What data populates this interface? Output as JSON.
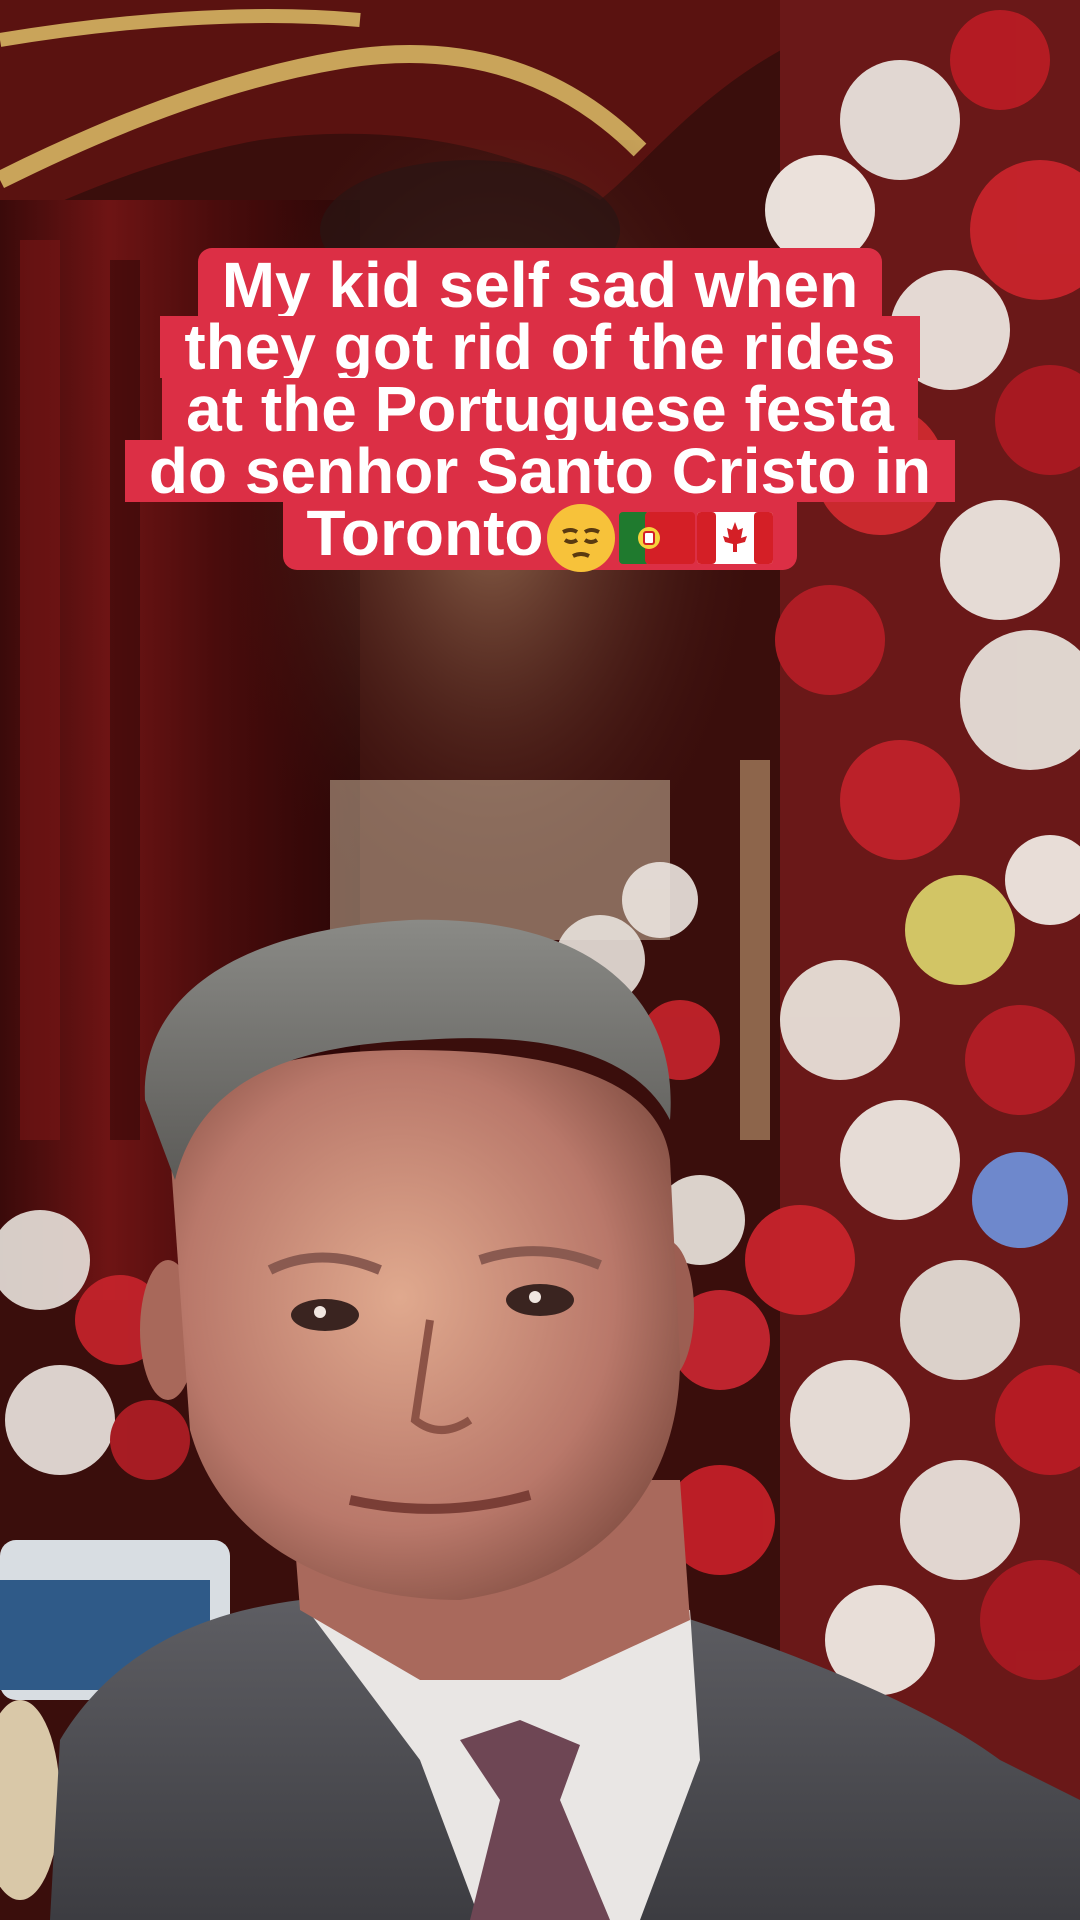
{
  "caption": {
    "lines": [
      "My kid self sad when",
      "they got rid of the rides",
      "at the Portuguese festa",
      "do senhor Santo Cristo in",
      "Toronto"
    ],
    "trailing_emojis": [
      "pensive-face",
      "portugal-flag",
      "canada-flag"
    ],
    "background_color": "#dc2f45",
    "text_color": "#ffffff"
  },
  "scene": {
    "icons": [
      "flower-altar",
      "red-curtain",
      "man-in-suit-cutout"
    ]
  }
}
